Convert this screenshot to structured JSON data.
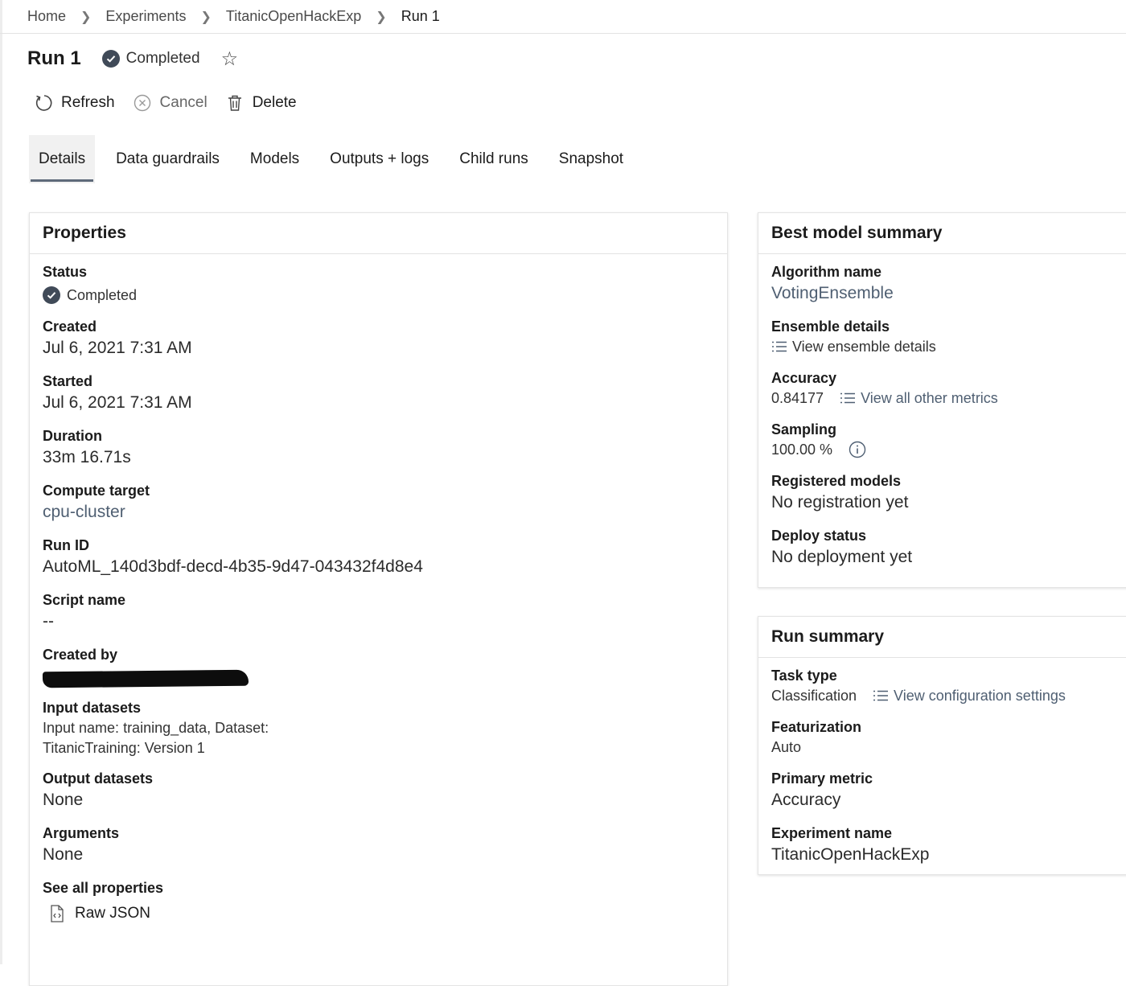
{
  "breadcrumb": [
    "Home",
    "Experiments",
    "TitanicOpenHackExp",
    "Run 1"
  ],
  "header": {
    "title": "Run 1",
    "status": "Completed"
  },
  "toolbar": {
    "refresh": "Refresh",
    "cancel": "Cancel",
    "delete": "Delete"
  },
  "tabs": [
    "Details",
    "Data guardrails",
    "Models",
    "Outputs + logs",
    "Child runs",
    "Snapshot"
  ],
  "active_tab": "Details",
  "properties": {
    "title": "Properties",
    "status_label": "Status",
    "status_value": "Completed",
    "created_label": "Created",
    "created_value": "Jul 6, 2021 7:31 AM",
    "started_label": "Started",
    "started_value": "Jul 6, 2021 7:31 AM",
    "duration_label": "Duration",
    "duration_value": "33m 16.71s",
    "compute_label": "Compute target",
    "compute_value": "cpu-cluster",
    "runid_label": "Run ID",
    "runid_value": "AutoML_140d3bdf-decd-4b35-9d47-043432f4d8e4",
    "script_label": "Script name",
    "script_value": "--",
    "createdby_label": "Created by",
    "input_label": "Input datasets",
    "input_value_line1": "Input name: training_data, Dataset:",
    "input_value_link": "TitanicTraining: Version 1",
    "output_label": "Output datasets",
    "output_value": "None",
    "args_label": "Arguments",
    "args_value": "None",
    "seeall_label": "See all properties",
    "raw_json": "Raw JSON"
  },
  "best_model": {
    "title": "Best model summary",
    "algo_label": "Algorithm name",
    "algo_value": "VotingEnsemble",
    "ensemble_label": "Ensemble details",
    "ensemble_link": "View ensemble details",
    "accuracy_label": "Accuracy",
    "accuracy_value": "0.84177",
    "metrics_link": "View all other metrics",
    "sampling_label": "Sampling",
    "sampling_value": "100.00 %",
    "registered_label": "Registered models",
    "registered_value": "No registration yet",
    "deploy_label": "Deploy status",
    "deploy_value": "No deployment yet"
  },
  "run_summary": {
    "title": "Run summary",
    "task_label": "Task type",
    "task_value": "Classification",
    "config_link": "View configuration settings",
    "feat_label": "Featurization",
    "feat_value": "Auto",
    "metric_label": "Primary metric",
    "metric_value": "Accuracy",
    "exp_label": "Experiment name",
    "exp_value": "TitanicOpenHackExp"
  }
}
